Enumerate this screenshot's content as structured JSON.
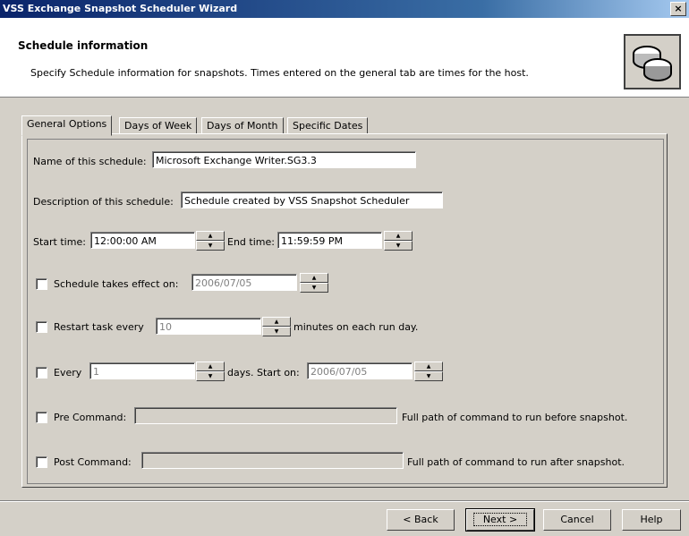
{
  "window": {
    "title": "VSS Exchange Snapshot Scheduler Wizard",
    "close_glyph": "×"
  },
  "header": {
    "title": "Schedule information",
    "description": "Specify Schedule information for snapshots. Times entered on the general tab are times for the host.",
    "icon": "snapshot-disks-icon"
  },
  "tabs": [
    "General Options",
    "Days of Week",
    "Days of Month",
    "Specific Dates"
  ],
  "form": {
    "name_label": "Name of this schedule:",
    "name_value": "Microsoft Exchange Writer.SG3.3",
    "desc_label": "Description of this schedule:",
    "desc_value": "Schedule created by VSS Snapshot Scheduler",
    "start_label": "Start time:",
    "start_value": "12:00:00 AM",
    "end_label": "End time:",
    "end_value": "11:59:59 PM",
    "effect_label": "Schedule takes effect on:",
    "effect_value": "2006/07/05",
    "restart_label": "Restart task every",
    "restart_value": "10",
    "restart_suffix": "minutes on each run day.",
    "every_label": "Every",
    "every_value": "1",
    "every_suffix": "days. Start on:",
    "every_start_value": "2006/07/05",
    "pre_label": "Pre Command:",
    "pre_value": "",
    "pre_hint": "Full path of command to run before snapshot.",
    "post_label": "Post Command:",
    "post_value": "",
    "post_hint": "Full path of command to run after snapshot."
  },
  "buttons": {
    "back": "< Back",
    "next": "Next >",
    "cancel": "Cancel",
    "help": "Help"
  }
}
